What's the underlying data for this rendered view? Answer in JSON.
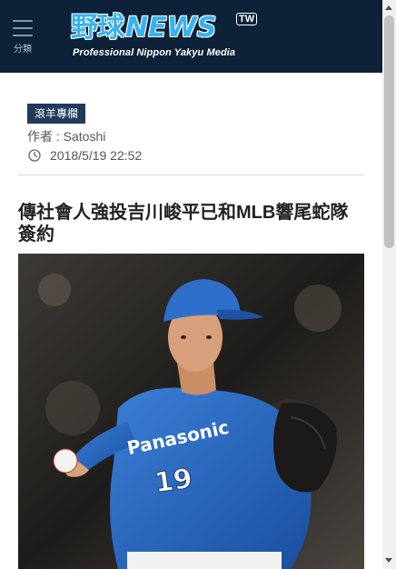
{
  "header": {
    "menu_label": "分類",
    "logo": {
      "kanji": "野球",
      "news": "NEWS",
      "tw": "TW",
      "subtitle": "Professional Nippon Yakyu Media"
    },
    "background_color": "#0d2238",
    "accent_color": "#36b3f0"
  },
  "article": {
    "category": "滾羊專欄",
    "author_prefix": "作者 : ",
    "author": "Satoshi",
    "date": "2018/5/19 22:52",
    "title": "傳社會人強投吉川峻平已和MLB響尾蛇隊簽約",
    "photo": {
      "jersey_text": "Panasonic",
      "jersey_number": "19"
    }
  },
  "icons": {
    "menu": "hamburger-icon",
    "date": "clock-icon"
  }
}
